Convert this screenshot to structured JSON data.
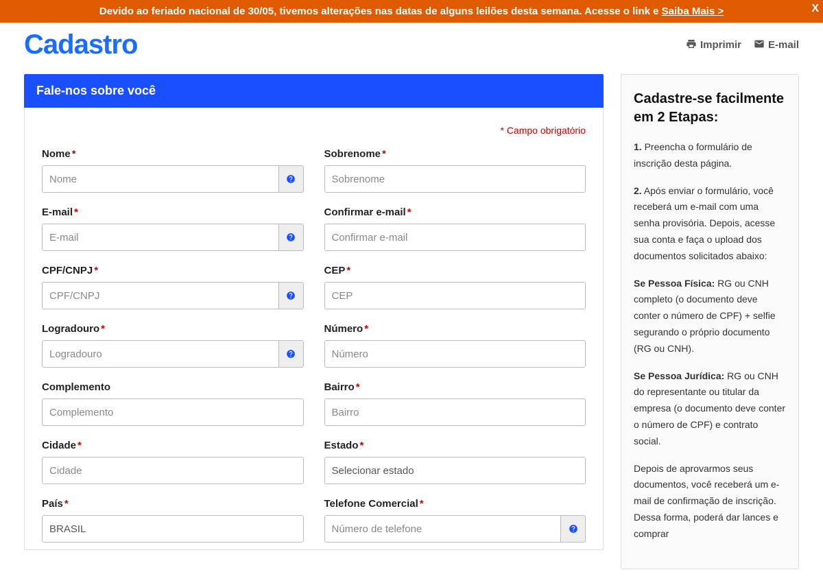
{
  "banner": {
    "text_before": "Devido ao feriado nacional de 30/05, tivemos alterações nas datas de alguns leilões desta semana.",
    "text_middle": " Acesse o link e ",
    "link": "Saiba Mais >",
    "close": "X"
  },
  "page_title": "Cadastro",
  "actions": {
    "print": "Imprimir",
    "email": "E-mail"
  },
  "panel": {
    "header": "Fale-nos sobre você",
    "required_note": "* Campo obrigatório"
  },
  "fields": {
    "nome": {
      "label": "Nome",
      "placeholder": "Nome"
    },
    "sobrenome": {
      "label": "Sobrenome",
      "placeholder": "Sobrenome"
    },
    "email": {
      "label": "E-mail",
      "placeholder": "E-mail"
    },
    "confirm_email": {
      "label": "Confirmar e-mail",
      "placeholder": "Confirmar e-mail"
    },
    "cpf": {
      "label": "CPF/CNPJ",
      "placeholder": "CPF/CNPJ"
    },
    "cep": {
      "label": "CEP",
      "placeholder": "CEP"
    },
    "logradouro": {
      "label": "Logradouro",
      "placeholder": "Logradouro"
    },
    "numero": {
      "label": "Número",
      "placeholder": "Número"
    },
    "complemento": {
      "label": "Complemento",
      "placeholder": "Complemento"
    },
    "bairro": {
      "label": "Bairro",
      "placeholder": "Bairro"
    },
    "cidade": {
      "label": "Cidade",
      "placeholder": "Cidade"
    },
    "estado": {
      "label": "Estado",
      "placeholder": "Selecionar estado"
    },
    "pais": {
      "label": "País",
      "value": "BRASIL"
    },
    "telefone": {
      "label": "Telefone Comercial",
      "placeholder": "Número de telefone"
    }
  },
  "sidebar": {
    "title": "Cadastre-se facilmente em 2 Etapas:",
    "p1_bold": "1.",
    "p1": " Preencha o formulário de inscrição desta página.",
    "p2_bold": "2.",
    "p2": " Após enviar o formulário, você receberá um e-mail com uma senha provisória. Depois, acesse sua conta e faça o upload dos documentos solicitados abaixo:",
    "p3_bold": "Se Pessoa Física:",
    "p3": " RG ou CNH completo (o documento deve conter o número de CPF) + selfie segurando o próprio documento (RG ou CNH).",
    "p4_bold": "Se Pessoa Jurídica:",
    "p4": " RG ou CNH do representante ou titular da empresa (o documento deve conter o número de CPF) e contrato social.",
    "p5": "Depois de aprovarmos seus documentos, você receberá um e-mail de confirmação de inscrição. Dessa forma, poderá dar lances e comprar"
  }
}
